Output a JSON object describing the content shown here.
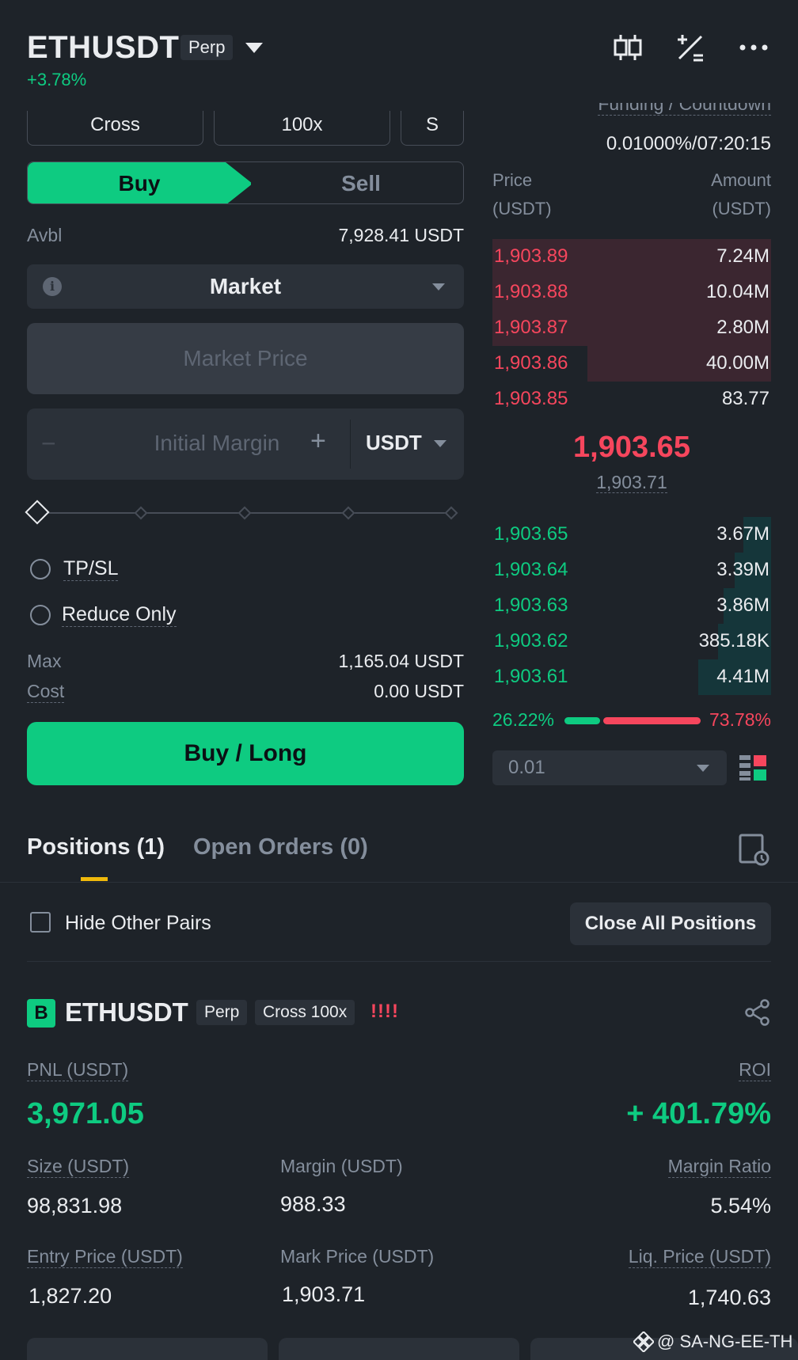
{
  "header": {
    "symbol": "ETHUSDT",
    "contract_type": "Perp",
    "change": "+3.78%",
    "icons": [
      "candlestick-chart-icon",
      "calculator-icon",
      "more-icon"
    ]
  },
  "order_form": {
    "margin_mode": "Cross",
    "leverage": "100x",
    "asset_mode": "S",
    "buy_tab": "Buy",
    "sell_tab": "Sell",
    "available_label": "Avbl",
    "available_value": "7,928.41 USDT",
    "order_type": "Market",
    "price_placeholder": "Market Price",
    "amount_minus": "−",
    "amount_placeholder": "Initial Margin",
    "amount_plus": "+",
    "amount_unit": "USDT",
    "tpsl_label": "TP/SL",
    "reduce_only_label": "Reduce Only",
    "max_label": "Max",
    "max_value": "1,165.04 USDT",
    "cost_label": "Cost",
    "cost_value": "0.00 USDT",
    "submit_label": "Buy / Long"
  },
  "order_book": {
    "funding_label": "Funding / Countdown",
    "funding_value": "0.01000%/07:20:15",
    "price_header": "Price",
    "price_unit": "(USDT)",
    "amount_header": "Amount",
    "amount_unit": "(USDT)",
    "asks": [
      {
        "price": "1,903.89",
        "amount": "7.24M",
        "depth": 1.0
      },
      {
        "price": "1,903.88",
        "amount": "10.04M",
        "depth": 1.0
      },
      {
        "price": "1,903.87",
        "amount": "2.80M",
        "depth": 1.0
      },
      {
        "price": "1,903.86",
        "amount": "40.00M",
        "depth": 0.66
      },
      {
        "price": "1,903.85",
        "amount": "83.77",
        "depth": 0.0
      }
    ],
    "last_price": "1,903.65",
    "mark_price": "1,903.71",
    "bids": [
      {
        "price": "1,903.65",
        "amount": "3.67M",
        "depth": 0.1
      },
      {
        "price": "1,903.64",
        "amount": "3.39M",
        "depth": 0.13
      },
      {
        "price": "1,903.63",
        "amount": "3.86M",
        "depth": 0.17
      },
      {
        "price": "1,903.62",
        "amount": "385.18K",
        "depth": 0.19
      },
      {
        "price": "1,903.61",
        "amount": "4.41M",
        "depth": 0.26
      }
    ],
    "buy_ratio": "26.22%",
    "sell_ratio": "73.78%",
    "buy_ratio_value": 0.2622,
    "tick_size": "0.01"
  },
  "tabs": {
    "positions": "Positions (1)",
    "open_orders": "Open Orders (0)"
  },
  "positions": {
    "hide_other_pairs": "Hide Other Pairs",
    "close_all": "Close All Positions",
    "item": {
      "side_badge": "B",
      "symbol": "ETHUSDT",
      "contract_type": "Perp",
      "margin_tag": "Cross 100x",
      "warning": "!!!!",
      "pnl_label": "PNL (USDT)",
      "pnl_value": "3,971.05",
      "roi_label": "ROI",
      "roi_value": "+ 401.79%",
      "size_label": "Size (USDT)",
      "size_value": "98,831.98",
      "margin_label": "Margin (USDT)",
      "margin_value": "988.33",
      "margin_ratio_label": "Margin Ratio",
      "margin_ratio_value": "5.54%",
      "entry_label": "Entry Price (USDT)",
      "entry_value": "1,827.20",
      "mark_label": "Mark Price (USDT)",
      "mark_value": "1,903.71",
      "liq_label": "Liq. Price (USDT)",
      "liq_value": "1,740.63"
    }
  },
  "watermark": "@ SA-NG-EE-TH",
  "colors": {
    "background": "#1e2329",
    "green": "#0ecb81",
    "red": "#f6465d",
    "accent": "#f0b90b"
  }
}
